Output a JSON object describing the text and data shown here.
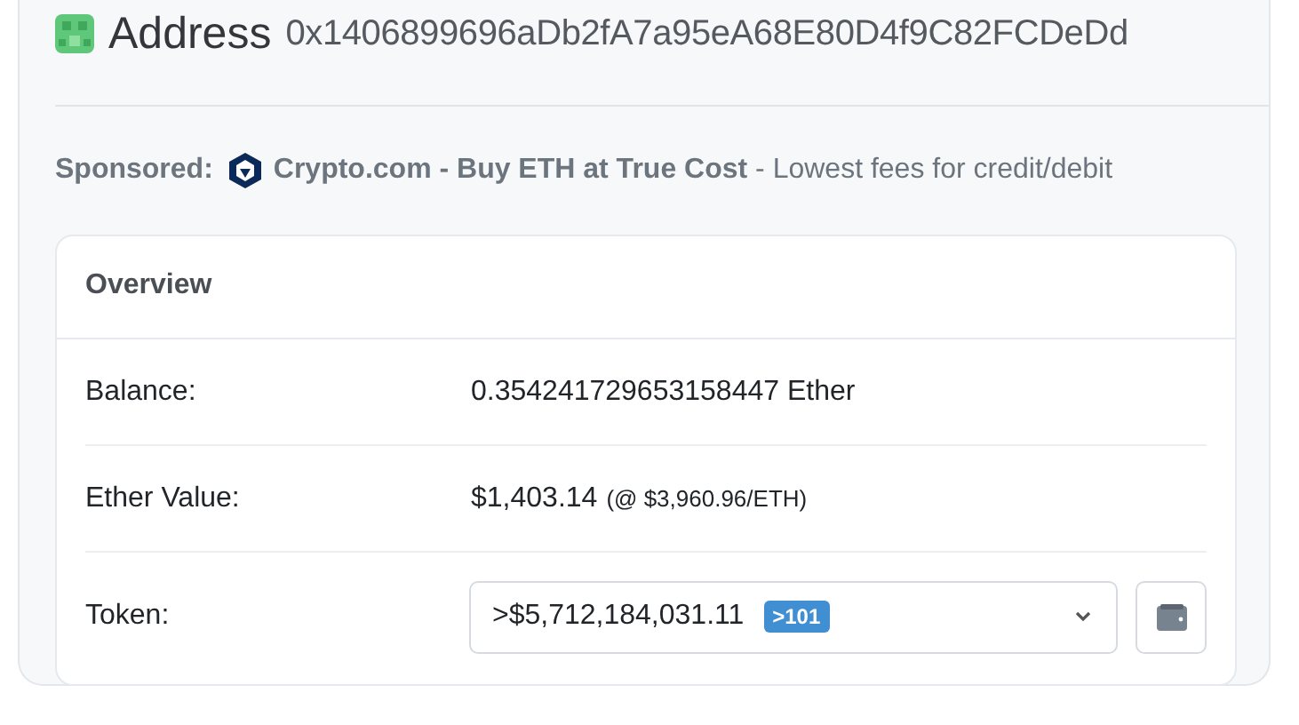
{
  "header": {
    "title": "Address",
    "address": "0x1406899696aDb2fA7a95eA68E80D4f9C82FCDeDd"
  },
  "sponsored": {
    "label": "Sponsored:",
    "link": "Crypto.com - Buy ETH at True Cost",
    "text": " - Lowest fees for credit/debit"
  },
  "overview": {
    "title": "Overview",
    "rows": [
      {
        "kind": "text",
        "label": "Balance:",
        "value": "0.354241729653158447 Ether"
      },
      {
        "kind": "price",
        "label": "Ether Value:",
        "value": "$1,403.14",
        "note": "(@ $3,960.96/ETH)"
      },
      {
        "kind": "dropdown",
        "label": "Token:",
        "value": ">$5,712,184,031.11",
        "badge": ">101"
      }
    ]
  }
}
